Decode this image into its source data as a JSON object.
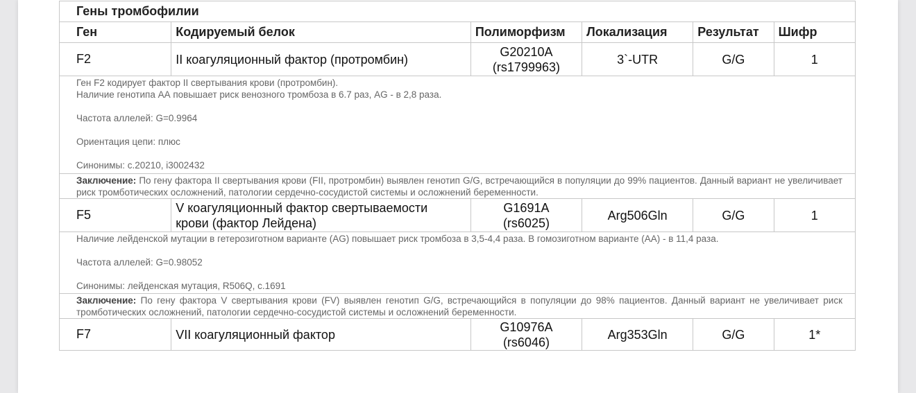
{
  "section_title": "Гены тромбофилии",
  "headers": {
    "gene": "Ген",
    "protein": "Кодируемый белок",
    "polymorphism": "Полиморфизм",
    "localization": "Локализация",
    "result": "Результат",
    "code": "Шифр"
  },
  "rows": [
    {
      "gene": "F2",
      "protein_line1": "II коагуляционный фактор (протромбин)",
      "protein_line2": "",
      "polymorphism": "G20210A",
      "rs": "(rs1799963)",
      "localization": "3`-UTR",
      "result": "G/G",
      "code": "1",
      "description": {
        "line1": "Ген F2 кодирует фактор II свертывания крови (протромбин).",
        "line2": "Наличие генотипа АА повышает риск венозного тромбоза в 6.7 раз, AG - в 2,8 раза.",
        "line3": "Частота аллелей: G=0.9964",
        "line4": "Ориентация цепи: плюс",
        "line5": "Синонимы: c.20210, i3002432"
      },
      "conclusion_label": "Заключение:",
      "conclusion_text": "По гену фактора II свертывания крови (FII, протромбин) выявлен генотип G/G, встречающийся в популяции до 99% пациентов. Данный вариант не увеличивает риск тромботических осложнений, патологии сердечно-сосудистой системы и осложнений беременности."
    },
    {
      "gene": "F5",
      "protein_line1": "V коагуляционный фактор свертываемости",
      "protein_line2": "крови (фактор Лейдена)",
      "polymorphism": "G1691A",
      "rs": "(rs6025)",
      "localization": "Arg506Gln",
      "result": "G/G",
      "code": "1",
      "description": {
        "line1": "Наличие лейденской мутации в гетерозиготном варианте (AG) повышает риск тромбоза в 3,5-4,4 раза. В гомозиготном варианте (АА) - в 11,4 раза.",
        "line2": "Частота аллелей: G=0.98052",
        "line3": "Синонимы: лейденская мутация, R506Q, c.1691"
      },
      "conclusion_label": "Заключение:",
      "conclusion_text": "По гену фактора V свертывания крови (FV) выявлен генотип G/G, встречающийся в популяции до 98% пациентов. Данный вариант не увеличивает риск тромботических осложнений, патологии сердечно-сосудистой системы и осложнений беременности."
    },
    {
      "gene": "F7",
      "protein_line1": "VII коагуляционный фактор",
      "protein_line2": "",
      "polymorphism": "G10976A",
      "rs": "(rs6046)",
      "localization": "Arg353Gln",
      "result": "G/G",
      "code": "1*"
    }
  ]
}
